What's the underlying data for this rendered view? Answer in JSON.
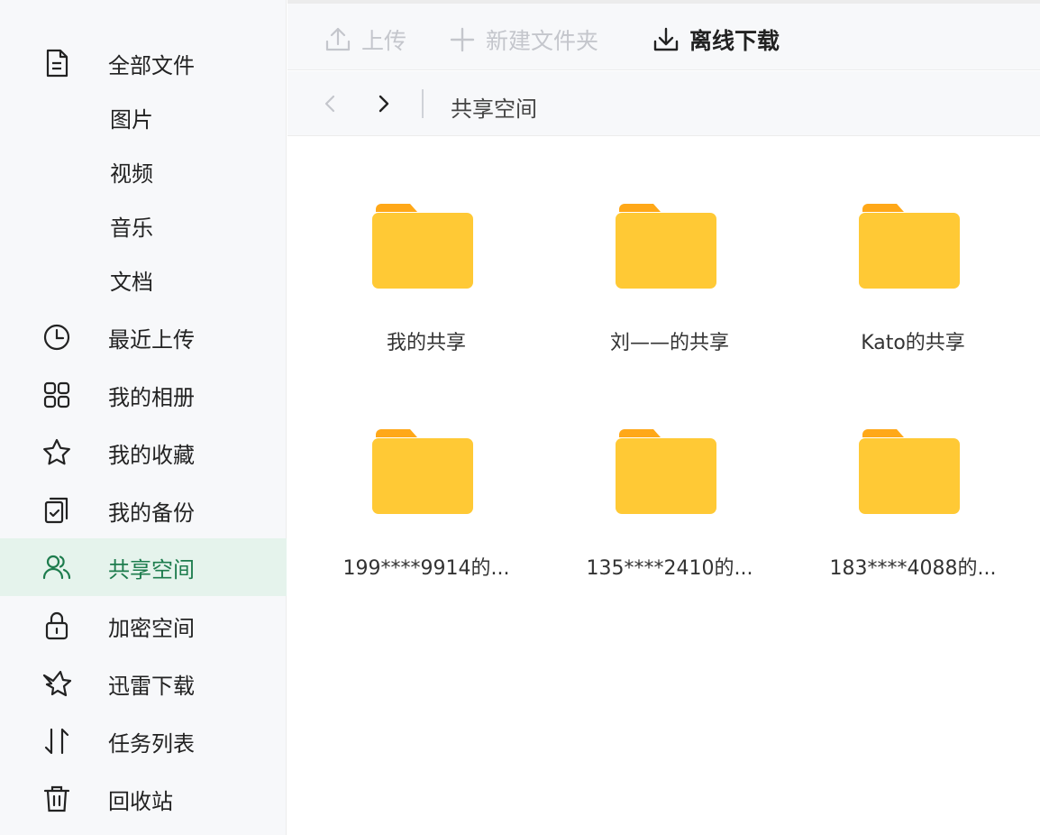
{
  "sidebar": {
    "items": [
      {
        "label": "全部文件",
        "icon": "file-icon",
        "sub": false,
        "active": false
      },
      {
        "label": "图片",
        "icon": "",
        "sub": true,
        "active": false
      },
      {
        "label": "视频",
        "icon": "",
        "sub": true,
        "active": false
      },
      {
        "label": "音乐",
        "icon": "",
        "sub": true,
        "active": false
      },
      {
        "label": "文档",
        "icon": "",
        "sub": true,
        "active": false
      },
      {
        "label": "最近上传",
        "icon": "clock-icon",
        "sub": false,
        "active": false
      },
      {
        "label": "我的相册",
        "icon": "grid-icon",
        "sub": false,
        "active": false
      },
      {
        "label": "我的收藏",
        "icon": "star-icon",
        "sub": false,
        "active": false
      },
      {
        "label": "我的备份",
        "icon": "backup-icon",
        "sub": false,
        "active": false
      },
      {
        "label": "共享空间",
        "icon": "users-icon",
        "sub": false,
        "active": true
      },
      {
        "label": "加密空间",
        "icon": "lock-icon",
        "sub": false,
        "active": false
      },
      {
        "label": "迅雷下载",
        "icon": "bird-icon",
        "sub": false,
        "active": false
      },
      {
        "label": "任务列表",
        "icon": "transfer-icon",
        "sub": false,
        "active": false
      },
      {
        "label": "回收站",
        "icon": "trash-icon",
        "sub": false,
        "active": false
      }
    ]
  },
  "toolbar": {
    "upload_label": "上传",
    "new_folder_label": "新建文件夹",
    "offline_download_label": "离线下载"
  },
  "pathbar": {
    "current": "共享空间"
  },
  "folders": [
    {
      "name": "我的共享"
    },
    {
      "name": "刘——的共享"
    },
    {
      "name": "Kato的共享"
    },
    {
      "name": "199****9914的..."
    },
    {
      "name": "135****2410的..."
    },
    {
      "name": "183****4088的..."
    }
  ],
  "colors": {
    "folder_body": "#ffc935",
    "folder_tab": "#ffa818",
    "active_bg": "#e5f3ec",
    "active_text": "#1d7c4d"
  }
}
